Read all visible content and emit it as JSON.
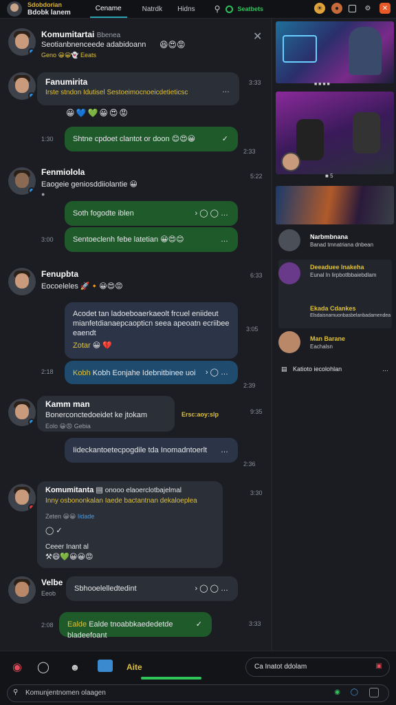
{
  "topbar": {
    "user_status": "Sdobdorian",
    "user_name": "Bdobk lanem",
    "tabs": [
      "Cename",
      "Natrdk",
      "Hidns"
    ],
    "status_label": "Seatbets",
    "accent": "#2ec45a"
  },
  "chat": {
    "messages": [
      {
        "name": "Komumitartai",
        "tag": "Bbenea",
        "text": "Seotianbnenceede adabidoann",
        "sub": "Geno",
        "sub2": "Eeats",
        "time": ""
      },
      {
        "name": "Fanumirita",
        "text": "Irste stndon Idutisel Sestoeimocnoeicdetieticsc",
        "time": "3:33",
        "ellipsis": "…"
      },
      {
        "bubble": "Shtne cpdoet clantot or doon",
        "time_left": "1:30",
        "time_right": "2:33",
        "check": "✓"
      },
      {
        "name": "Fenmiolola",
        "text": "Eaogeie geniosddiiolantie",
        "time": "5:22"
      },
      {
        "bubble": "Soth fogodte iblen",
        "label": "Soth"
      },
      {
        "bubble": "Sentoeclenh febe latetian",
        "time_left": "3:00"
      },
      {
        "name": "Fenupbta",
        "text": "Eocoeleles",
        "time": "6:33"
      },
      {
        "bubble": "Acodet tan ladoeboaerkaeolt frcuel eniideut mianfetdianaepcaopticn seea apeoatn ecriibee eaendt",
        "sub": "Zotar",
        "time": "3:05"
      },
      {
        "bubble": "Kobh Eonjahe Idebnitbinee uoi",
        "time_left": "2:18",
        "time_right": "2:39",
        "label": "Kobh"
      },
      {
        "name": "Kamm man",
        "text": "Bonerconctedoeidet ke jtokam",
        "sub": "Eolo",
        "sub2": "Gebia",
        "yellow": "Ersc:aoy:slp",
        "time": "9:35"
      },
      {
        "bubble": "Iideckantoetecpogdile tda Inomadntoerlt",
        "time": "2:36"
      },
      {
        "name": "Komumitanta",
        "inline": "onooo elaoerclotbajelmal",
        "text": "Inny osbononkalan Iaede bactantnan dekaloeplea",
        "sub": "Zeten",
        "sub2": "Iidade",
        "author": "Ceeer Inant al",
        "time": "3:30"
      },
      {
        "name": "Velbe",
        "bubble": "Sbhooelelledtedint",
        "sub": "Eeob"
      },
      {
        "bubble": "Ealde tnoabbkaededetde bladeefoant",
        "label": "Ealde",
        "time_left": "2:08",
        "time_right": "3:33"
      }
    ]
  },
  "sidebar": {
    "card2_time": "5",
    "items": [
      {
        "title": "Narbmbnana",
        "sub": "Banad tmnatriana dnbean"
      },
      {
        "title": "Deeaduee Inakeha",
        "sub": "Eunal In lirpbotlbbaiebdlam"
      },
      {
        "title": "Ekada Cdankes",
        "sub": "Elsdaisnamuonbasbelanbadamendea"
      },
      {
        "title": "Man Barane",
        "sub": "Eachalsn"
      }
    ],
    "footer": "Katioto iecolohlan"
  },
  "bottom": {
    "nav_label": "Aite",
    "search_label": "Ca Inatot ddolam",
    "compose_placeholder": "Komunjentnomen olaagen"
  }
}
